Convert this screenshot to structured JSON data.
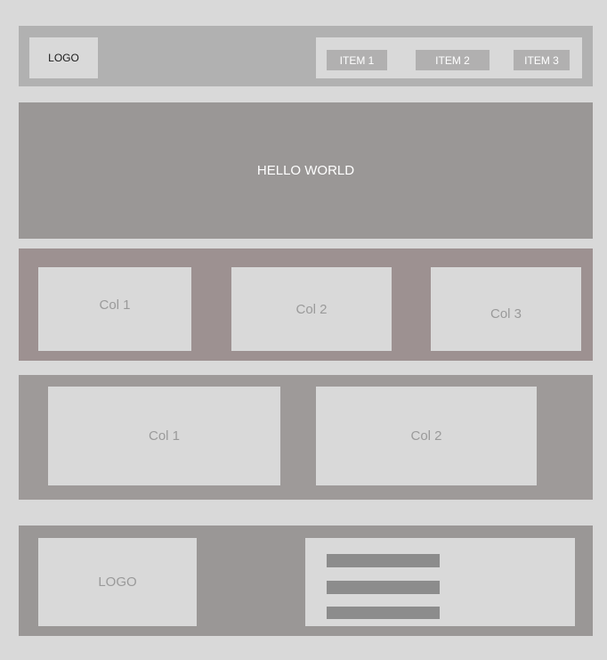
{
  "header": {
    "logo": "LOGO",
    "nav": [
      "ITEM 1",
      "ITEM 2",
      "ITEM 3"
    ]
  },
  "hero": {
    "title": "HELLO WORLD"
  },
  "three_columns": [
    "Col 1",
    "Col 2",
    "Col 3"
  ],
  "two_columns": [
    "Col 1",
    "Col 2"
  ],
  "footer": {
    "logo": "LOGO",
    "link_placeholders": 3
  }
}
